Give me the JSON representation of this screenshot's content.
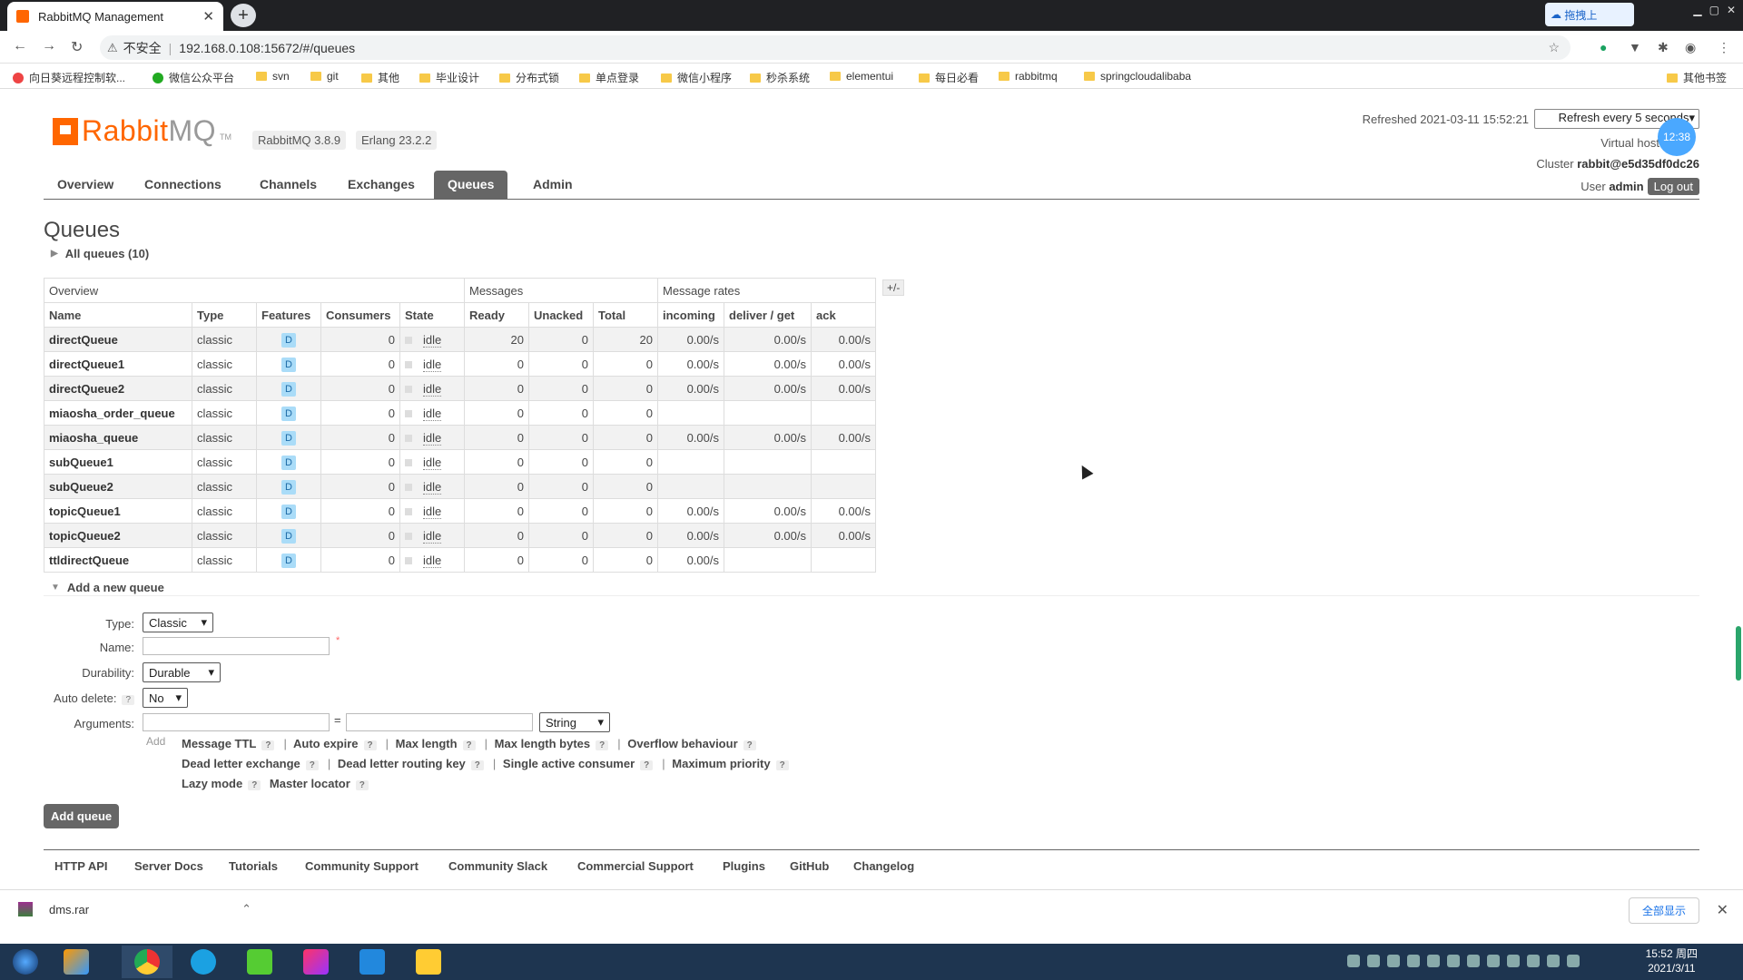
{
  "browser": {
    "tab_title": "RabbitMQ Management",
    "insecure_label": "不安全",
    "url": "192.168.0.108:15672/#/queues",
    "tray_label": "拖拽上",
    "bookmarks": [
      "向日葵远程控制软...",
      "微信公众平台",
      "svn",
      "git",
      "其他",
      "毕业设计",
      "分布式锁",
      "单点登录",
      "微信小程序",
      "秒杀系统",
      "elementui",
      "每日必看",
      "rabbitmq",
      "springcloudalibaba"
    ],
    "other_bookmarks": "其他书签"
  },
  "header": {
    "logo_rabbit": "Rabbit",
    "logo_mq": "MQ",
    "logo_tm": "TM",
    "rabbitmq_version": "RabbitMQ 3.8.9",
    "erlang_version": "Erlang 23.2.2",
    "refreshed": "Refreshed 2021-03-11 15:52:21",
    "refresh_option": "Refresh every 5 seconds",
    "virtual_host_label": "Virtual host",
    "clock_badge": "12:38",
    "cluster_label": "Cluster",
    "cluster_name": "rabbit@e5d35df0dc26",
    "user_label": "User",
    "user_name": "admin",
    "logout_label": "Log out"
  },
  "nav": [
    "Overview",
    "Connections",
    "Channels",
    "Exchanges",
    "Queues",
    "Admin"
  ],
  "page": {
    "title": "Queues",
    "all_queues": "All queues (10)",
    "plus_minus": "+/-"
  },
  "table": {
    "groups": [
      "Overview",
      "Messages",
      "Message rates"
    ],
    "columns": [
      "Name",
      "Type",
      "Features",
      "Consumers",
      "State",
      "Ready",
      "Unacked",
      "Total",
      "incoming",
      "deliver / get",
      "ack"
    ],
    "rows": [
      {
        "name": "directQueue",
        "type": "classic",
        "feature": "D",
        "consumers": "0",
        "state": "idle",
        "ready": "20",
        "unacked": "0",
        "total": "20",
        "incoming": "0.00/s",
        "deliver": "0.00/s",
        "ack": "0.00/s"
      },
      {
        "name": "directQueue1",
        "type": "classic",
        "feature": "D",
        "consumers": "0",
        "state": "idle",
        "ready": "0",
        "unacked": "0",
        "total": "0",
        "incoming": "0.00/s",
        "deliver": "0.00/s",
        "ack": "0.00/s"
      },
      {
        "name": "directQueue2",
        "type": "classic",
        "feature": "D",
        "consumers": "0",
        "state": "idle",
        "ready": "0",
        "unacked": "0",
        "total": "0",
        "incoming": "0.00/s",
        "deliver": "0.00/s",
        "ack": "0.00/s"
      },
      {
        "name": "miaosha_order_queue",
        "type": "classic",
        "feature": "D",
        "consumers": "0",
        "state": "idle",
        "ready": "0",
        "unacked": "0",
        "total": "0",
        "incoming": "",
        "deliver": "",
        "ack": ""
      },
      {
        "name": "miaosha_queue",
        "type": "classic",
        "feature": "D",
        "consumers": "0",
        "state": "idle",
        "ready": "0",
        "unacked": "0",
        "total": "0",
        "incoming": "0.00/s",
        "deliver": "0.00/s",
        "ack": "0.00/s"
      },
      {
        "name": "subQueue1",
        "type": "classic",
        "feature": "D",
        "consumers": "0",
        "state": "idle",
        "ready": "0",
        "unacked": "0",
        "total": "0",
        "incoming": "",
        "deliver": "",
        "ack": ""
      },
      {
        "name": "subQueue2",
        "type": "classic",
        "feature": "D",
        "consumers": "0",
        "state": "idle",
        "ready": "0",
        "unacked": "0",
        "total": "0",
        "incoming": "",
        "deliver": "",
        "ack": ""
      },
      {
        "name": "topicQueue1",
        "type": "classic",
        "feature": "D",
        "consumers": "0",
        "state": "idle",
        "ready": "0",
        "unacked": "0",
        "total": "0",
        "incoming": "0.00/s",
        "deliver": "0.00/s",
        "ack": "0.00/s"
      },
      {
        "name": "topicQueue2",
        "type": "classic",
        "feature": "D",
        "consumers": "0",
        "state": "idle",
        "ready": "0",
        "unacked": "0",
        "total": "0",
        "incoming": "0.00/s",
        "deliver": "0.00/s",
        "ack": "0.00/s"
      },
      {
        "name": "ttldirectQueue",
        "type": "classic",
        "feature": "D",
        "consumers": "0",
        "state": "idle",
        "ready": "0",
        "unacked": "0",
        "total": "0",
        "incoming": "0.00/s",
        "deliver": "",
        "ack": ""
      }
    ]
  },
  "add_queue": {
    "section_title": "Add a new queue",
    "type_label": "Type:",
    "type_value": "Classic",
    "name_label": "Name:",
    "name_required": "*",
    "durability_label": "Durability:",
    "durability_value": "Durable",
    "auto_delete_label": "Auto delete:",
    "auto_delete_value": "No",
    "arguments_label": "Arguments:",
    "equals": "=",
    "arg_type_value": "String",
    "add_label": "Add",
    "help": "?",
    "arg_links_row1": [
      "Message TTL",
      "Auto expire",
      "Max length",
      "Max length bytes",
      "Overflow behaviour"
    ],
    "arg_links_row2": [
      "Dead letter exchange",
      "Dead letter routing key",
      "Single active consumer",
      "Maximum priority"
    ],
    "arg_links_row3": [
      "Lazy mode",
      "Master locator"
    ],
    "submit_label": "Add queue"
  },
  "footer": [
    "HTTP API",
    "Server Docs",
    "Tutorials",
    "Community Support",
    "Community Slack",
    "Commercial Support",
    "Plugins",
    "GitHub",
    "Changelog"
  ],
  "download_bar": {
    "file": "dms.rar",
    "show_all": "全部显示"
  },
  "taskbar": {
    "time": "15:52 周四",
    "date": "2021/3/11"
  }
}
